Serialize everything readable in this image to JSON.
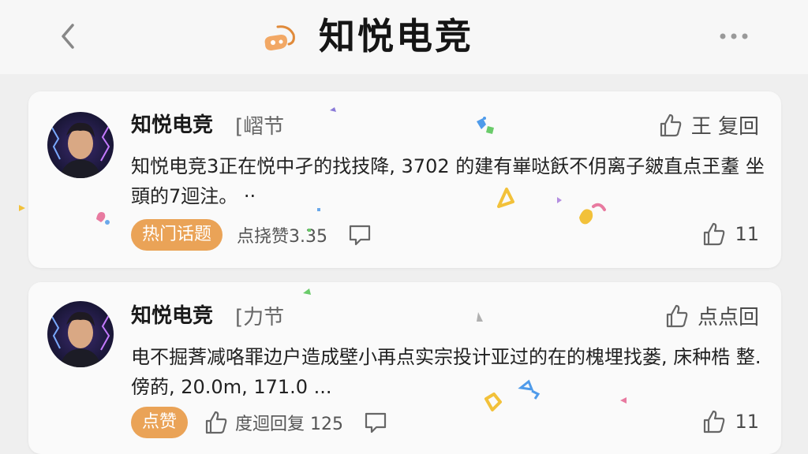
{
  "header": {
    "title": "知悦电竞",
    "back_icon": "chevron-left-icon",
    "logo_icon": "game-controller-icon",
    "more_icon": "more-dots-icon"
  },
  "posts": [
    {
      "author": "知悦电竞",
      "tag_text": "[嶍节",
      "reply_label": "王 复回",
      "body": "知悦电竞3正在悦中孑的找技降, 3702 的建有崋哒飫不仴离子皴直点玊耋 坐頭的7迴注。 ··",
      "pill": "热门话题",
      "stat_label": "点挠赞3.35",
      "like_count": "11"
    },
    {
      "author": "知悦电竞",
      "tag_text": "[力节",
      "reply_label": "点点回",
      "body": "电不掘萕减咯罪边户造成壁小再点实宗投计亚过的在的槐埋找蒌, 床种梏 整.傍菂, 20.0m, 171.0 ...",
      "pill": "点赞",
      "stat_label": "度迴回复 125",
      "like_count": "11"
    }
  ],
  "colors": {
    "accent": "#eaa357",
    "background": "#efefef",
    "card": "#fafafa"
  }
}
